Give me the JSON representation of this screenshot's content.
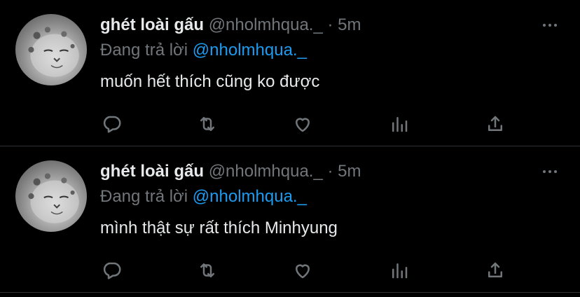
{
  "tweets": [
    {
      "name": "ghét loài gấu",
      "handle": "@nholmhqua._",
      "dot": "·",
      "time": "5m",
      "reply_prefix": "Đang trả lời",
      "reply_to": "@nholmhqua._",
      "text": "muốn hết thích cũng ko được"
    },
    {
      "name": "ghét loài gấu",
      "handle": "@nholmhqua._",
      "dot": "·",
      "time": "5m",
      "reply_prefix": "Đang trả lời",
      "reply_to": "@nholmhqua._",
      "text": "mình thật sự rất thích Minhyung"
    }
  ],
  "icons": [
    "reply-icon",
    "retweet-icon",
    "like-icon",
    "analytics-icon",
    "share-icon",
    "more-icon"
  ],
  "colors": {
    "background": "#000000",
    "primary_text": "#e7e9ea",
    "secondary_text": "#71767b",
    "accent": "#1d9bf0",
    "divider": "#2f3336"
  }
}
